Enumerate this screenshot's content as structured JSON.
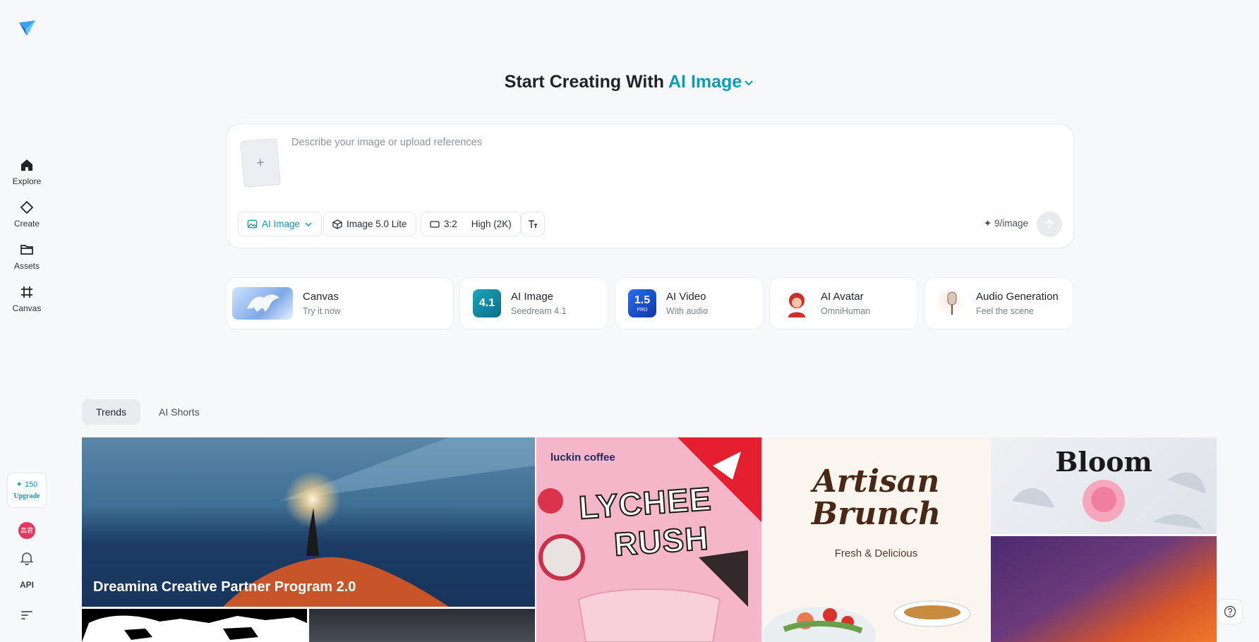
{
  "sidebar": {
    "items": [
      {
        "label": "Explore"
      },
      {
        "label": "Create"
      },
      {
        "label": "Assets"
      },
      {
        "label": "Canvas"
      }
    ],
    "credits": "✦ 150",
    "upgrade": "Upgrade",
    "avatar_text": "高君",
    "api": "API"
  },
  "heading": {
    "prefix": "Start Creating With",
    "mode": "AI Image"
  },
  "prompt": {
    "placeholder": "Describe your image or upload references",
    "upload_symbol": "+",
    "mode_button": "AI Image",
    "model_button": "Image 5.0 Lite",
    "ratio": "3:2",
    "quality": "High (2K)",
    "cost": "✦ 9/image"
  },
  "cards": [
    {
      "title": "Canvas",
      "subtitle": "Try it now"
    },
    {
      "title": "AI Image",
      "subtitle": "Seedream 4.1",
      "badge": "4.1"
    },
    {
      "title": "AI Video",
      "subtitle": "With audio",
      "badge": "1.5",
      "badge_sub": "PRO"
    },
    {
      "title": "AI Avatar",
      "subtitle": "OmniHuman"
    },
    {
      "title": "Audio Generation",
      "subtitle": "Feel the scene"
    }
  ],
  "tabs": [
    {
      "label": "Trends"
    },
    {
      "label": "AI Shorts"
    }
  ],
  "gallery": {
    "banner_title": "Dreamina Creative Partner Program 2.0",
    "lychee_brand": "luckin coffee",
    "lychee_line1": "LYCHEE",
    "lychee_line2": "RUSH",
    "brunch_line1": "Artisan",
    "brunch_line2": "Brunch",
    "brunch_sub": "Fresh & Delicious",
    "bloom_title": "Bloom"
  },
  "colors": {
    "accent": "#0e9bb5",
    "background": "#f7f8fa"
  }
}
